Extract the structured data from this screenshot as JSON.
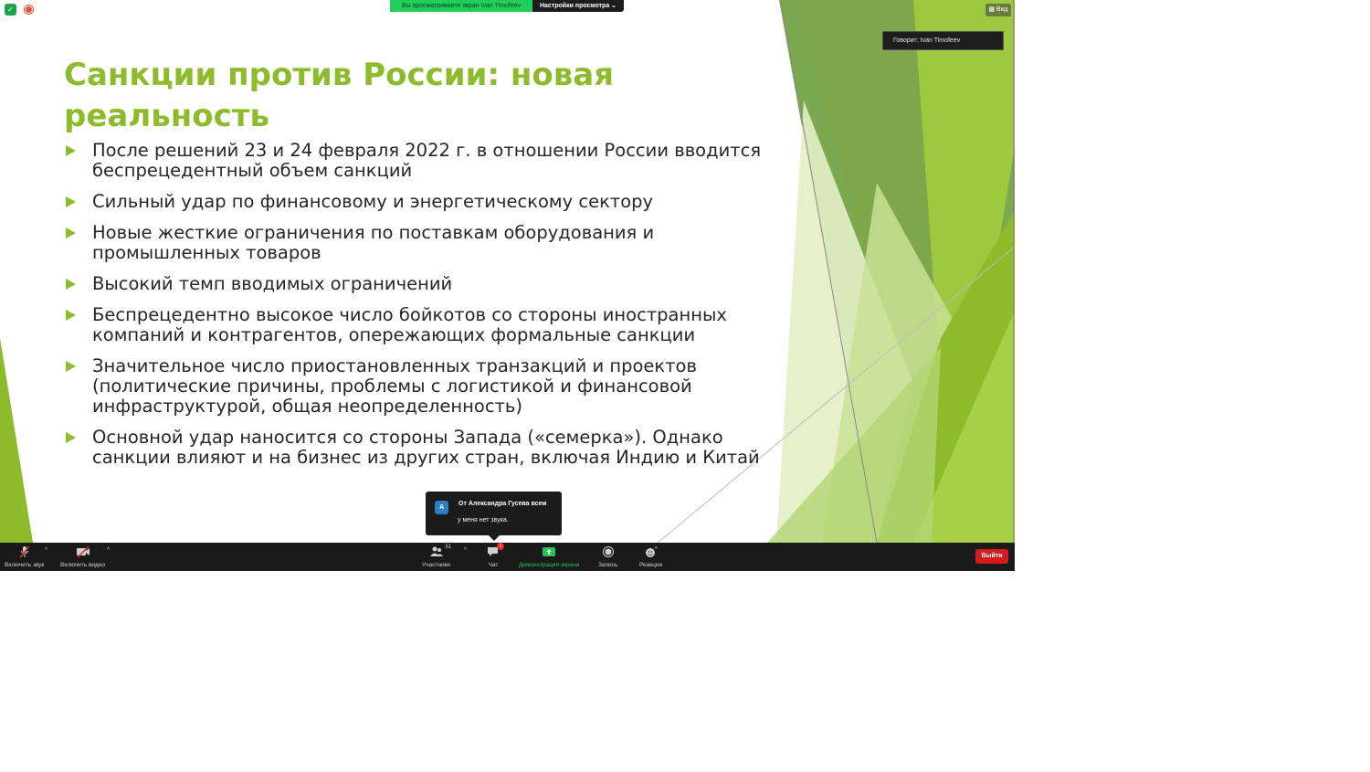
{
  "slide": {
    "title": "Санкции против России: новая реальность",
    "bullets": [
      "После решений 23 и 24 февраля 2022 г. в отношении России вводится беспрецедентный объем санкций",
      "Сильный удар по финансовому и энергетическому сектору",
      "Новые жесткие ограничения по поставкам оборудования и промышленных товаров",
      "Высокий темп вводимых ограничений",
      "Беспрецедентно высокое число бойкотов со стороны иностранных компаний и контрагентов, опережающих формальные санкции",
      "Значительное число приостановленных транзакций и проектов (политические причины, проблемы с логистикой и финансовой инфраструктурой, общая неопределенность)",
      "Основной удар наносится со стороны Запада («семерка»). Однако санкции влияют и на бизнес из других стран, включая Индию и Китай"
    ],
    "accent_color": "#8dbb2c"
  },
  "share_banner": {
    "viewing_text": "Вы просматриваете экран Ivan Timofeev",
    "view_options_label": "Настройки просмотра ⌄"
  },
  "view_button_label": "▦ Вид",
  "speaker_label": "Говорит: Ivan Timofeev",
  "chat_popup": {
    "avatar_letter": "А",
    "from": "От Александра Гусева всем",
    "message": "у меня нет звука."
  },
  "toolbar": {
    "unmute_label": "Включить звук",
    "start_video_label": "Включить видео",
    "participants_label": "Участники",
    "participants_count": "51",
    "chat_label": "Чат",
    "chat_badge": "1",
    "share_label": "Демонстрация экрана",
    "record_label": "Запись",
    "reactions_label": "Реакции",
    "leave_label": "Выйти",
    "caret": "^"
  },
  "colors": {
    "toolbar_bg": "#1a1a1a",
    "share_green": "#1fcf5a",
    "leave_red": "#d31c1c"
  }
}
